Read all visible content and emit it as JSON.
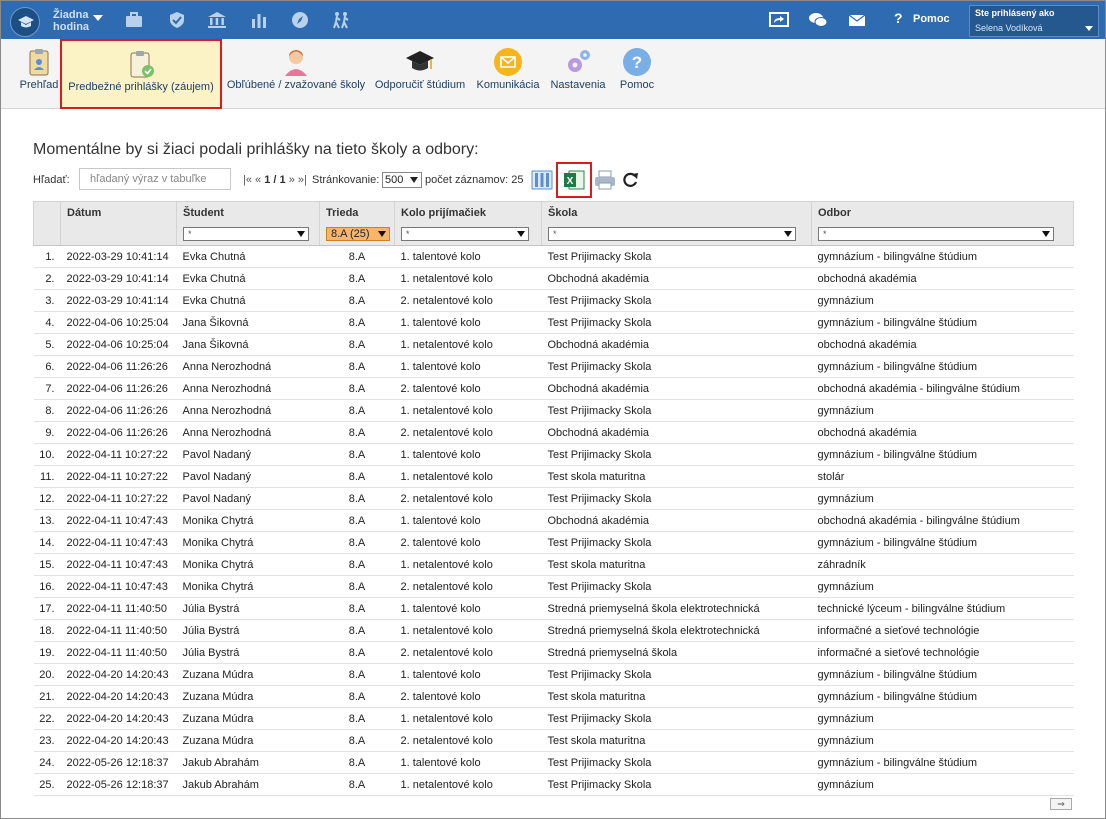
{
  "topbar": {
    "hour_line1": "Žiadna",
    "hour_line2": "hodina",
    "help_label": "Pomoc",
    "user_title": "Ste prihlásený ako",
    "user_name": "Selena Vodíková"
  },
  "toolbar": {
    "items": [
      {
        "label": "Prehľad",
        "icon": "overview-clipboard-icon"
      },
      {
        "label": "Predbežné prihlášky (záujem)",
        "icon": "clipboard-check-icon"
      },
      {
        "label": "Obľúbené / zvažované školy",
        "icon": "person-icon"
      },
      {
        "label": "Odporučiť štúdium",
        "icon": "graduation-cap-icon"
      },
      {
        "label": "Komunikácia",
        "icon": "envelope-icon"
      },
      {
        "label": "Nastavenia",
        "icon": "gears-icon"
      },
      {
        "label": "Pomoc",
        "icon": "question-icon"
      }
    ]
  },
  "heading": "Momentálne by si žiaci podali prihlášky na tieto školy a odbory:",
  "filter": {
    "search_label": "Hľadať:",
    "search_placeholder": "hľadaný výraz v tabuľke",
    "pager_first": "|«",
    "pager_prev": "«",
    "pager_pages": "1 / 1",
    "pager_next": "»",
    "pager_last": "»|",
    "paging_label": "Stránkovanie:",
    "paging_value": "500",
    "count_label": "počet záznamov: 25"
  },
  "table": {
    "columns": [
      "",
      "Dátum",
      "Študent",
      "Trieda",
      "Kolo prijímačiek",
      "Škola",
      "Odbor"
    ],
    "filters": [
      "",
      "",
      "*",
      "8.A (25)",
      "*",
      "*",
      "*"
    ],
    "rows": [
      [
        "1.",
        "2022-03-29 10:41:14",
        "Evka Chutná",
        "8.A",
        "1. talentové kolo",
        "Test Prijimacky Skola",
        "gymnázium - bilingválne štúdium"
      ],
      [
        "2.",
        "2022-03-29 10:41:14",
        "Evka Chutná",
        "8.A",
        "1. netalentové kolo",
        "Obchodná akadémia",
        "obchodná akadémia"
      ],
      [
        "3.",
        "2022-03-29 10:41:14",
        "Evka Chutná",
        "8.A",
        "2. netalentové kolo",
        "Test Prijimacky Skola",
        "gymnázium"
      ],
      [
        "4.",
        "2022-04-06 10:25:04",
        "Jana Šikovná",
        "8.A",
        "1. talentové kolo",
        "Test Prijimacky Skola",
        "gymnázium - bilingválne štúdium"
      ],
      [
        "5.",
        "2022-04-06 10:25:04",
        "Jana Šikovná",
        "8.A",
        "1. netalentové kolo",
        "Obchodná akadémia",
        "obchodná akadémia"
      ],
      [
        "6.",
        "2022-04-06 11:26:26",
        "Anna Nerozhodná",
        "8.A",
        "1. talentové kolo",
        "Test Prijimacky Skola",
        "gymnázium - bilingválne štúdium"
      ],
      [
        "7.",
        "2022-04-06 11:26:26",
        "Anna Nerozhodná",
        "8.A",
        "2. talentové kolo",
        "Obchodná akadémia",
        "obchodná akadémia - bilingválne štúdium"
      ],
      [
        "8.",
        "2022-04-06 11:26:26",
        "Anna Nerozhodná",
        "8.A",
        "1. netalentové kolo",
        "Test Prijimacky Skola",
        "gymnázium"
      ],
      [
        "9.",
        "2022-04-06 11:26:26",
        "Anna Nerozhodná",
        "8.A",
        "2. netalentové kolo",
        "Obchodná akadémia",
        "obchodná akadémia"
      ],
      [
        "10.",
        "2022-04-11 10:27:22",
        "Pavol Nadaný",
        "8.A",
        "1. talentové kolo",
        "Test Prijimacky Skola",
        "gymnázium - bilingválne štúdium"
      ],
      [
        "11.",
        "2022-04-11 10:27:22",
        "Pavol Nadaný",
        "8.A",
        "1. netalentové kolo",
        "Test skola maturitna",
        "stolár"
      ],
      [
        "12.",
        "2022-04-11 10:27:22",
        "Pavol Nadaný",
        "8.A",
        "2. netalentové kolo",
        "Test Prijimacky Skola",
        "gymnázium"
      ],
      [
        "13.",
        "2022-04-11 10:47:43",
        "Monika Chytrá",
        "8.A",
        "1. talentové kolo",
        "Obchodná akadémia",
        "obchodná akadémia - bilingválne štúdium"
      ],
      [
        "14.",
        "2022-04-11 10:47:43",
        "Monika Chytrá",
        "8.A",
        "2. talentové kolo",
        "Test Prijimacky Skola",
        "gymnázium - bilingválne štúdium"
      ],
      [
        "15.",
        "2022-04-11 10:47:43",
        "Monika Chytrá",
        "8.A",
        "1. netalentové kolo",
        "Test skola maturitna",
        "záhradník"
      ],
      [
        "16.",
        "2022-04-11 10:47:43",
        "Monika Chytrá",
        "8.A",
        "2. netalentové kolo",
        "Test Prijimacky Skola",
        "gymnázium"
      ],
      [
        "17.",
        "2022-04-11 11:40:50",
        "Júlia Bystrá",
        "8.A",
        "1. talentové kolo",
        "Stredná priemyselná škola elektrotechnická",
        "technické lýceum - bilingválne štúdium"
      ],
      [
        "18.",
        "2022-04-11 11:40:50",
        "Júlia Bystrá",
        "8.A",
        "1. netalentové kolo",
        "Stredná priemyselná škola elektrotechnická",
        "informačné a sieťové technológie"
      ],
      [
        "19.",
        "2022-04-11 11:40:50",
        "Júlia Bystrá",
        "8.A",
        "2. netalentové kolo",
        "Stredná priemyselná škola",
        "informačné a sieťové technológie"
      ],
      [
        "20.",
        "2022-04-20 14:20:43",
        "Zuzana Múdra",
        "8.A",
        "1. talentové kolo",
        "Test Prijimacky Skola",
        "gymnázium - bilingválne štúdium"
      ],
      [
        "21.",
        "2022-04-20 14:20:43",
        "Zuzana Múdra",
        "8.A",
        "2. talentové kolo",
        "Test skola maturitna",
        "gymnázium - bilingválne štúdium"
      ],
      [
        "22.",
        "2022-04-20 14:20:43",
        "Zuzana Múdra",
        "8.A",
        "1. netalentové kolo",
        "Test Prijimacky Skola",
        "gymnázium"
      ],
      [
        "23.",
        "2022-04-20 14:20:43",
        "Zuzana Múdra",
        "8.A",
        "2. netalentové kolo",
        "Test skola maturitna",
        "gymnázium"
      ],
      [
        "24.",
        "2022-05-26 12:18:37",
        "Jakub Abrahám",
        "8.A",
        "1. talentové kolo",
        "Test Prijimacky Skola",
        "gymnázium - bilingválne štúdium"
      ],
      [
        "25.",
        "2022-05-26 12:18:37",
        "Jakub Abrahám",
        "8.A",
        "1. netalentové kolo",
        "Test Prijimacky Skola",
        "gymnázium"
      ]
    ]
  },
  "colors": {
    "topbar": "#2e6bb0",
    "active_highlight": "#d91c1c",
    "class_filter": "#fbb46b"
  }
}
